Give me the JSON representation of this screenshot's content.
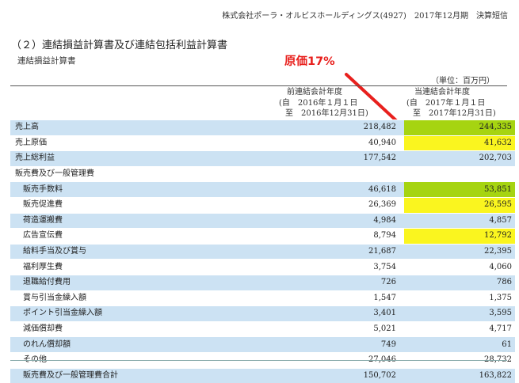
{
  "header": {
    "company_line": "株式会社ポーラ・オルビスホールディングス(4927)　2017年12月期　決算短信"
  },
  "section_title": "（２）連結損益計算書及び連結包括利益計算書",
  "sub_title": "連結損益計算書",
  "annotation": {
    "text": "原価17%",
    "color": "#e8201d"
  },
  "unit": "（単位：百万円）",
  "columns": {
    "prev": {
      "title": "前連結会計年度",
      "from": "(自　2016年１月１日",
      "to": "至　2016年12月31日)"
    },
    "curr": {
      "title": "当連結会計年度",
      "from": "(自　2017年１月１日",
      "to": "至　2017年12月31日)"
    }
  },
  "colors": {
    "row_blue": "#cce2f3",
    "highlight_green": "#a6d411",
    "highlight_yellow": "#faf51f"
  },
  "rows": [
    {
      "label": "売上高",
      "prev": "218,482",
      "curr": "244,335",
      "indent": 0,
      "band": "blue",
      "highlight": "green"
    },
    {
      "label": "売上原価",
      "prev": "40,940",
      "curr": "41,632",
      "indent": 0,
      "band": "white",
      "highlight": "yellow"
    },
    {
      "label": "売上総利益",
      "prev": "177,542",
      "curr": "202,703",
      "indent": 0,
      "band": "blue",
      "highlight": ""
    },
    {
      "label": "販売費及び一般管理費",
      "prev": "",
      "curr": "",
      "indent": 0,
      "band": "white",
      "highlight": ""
    },
    {
      "label": "販売手数料",
      "prev": "46,618",
      "curr": "53,851",
      "indent": 1,
      "band": "blue",
      "highlight": "green"
    },
    {
      "label": "販売促進費",
      "prev": "26,369",
      "curr": "26,595",
      "indent": 1,
      "band": "white",
      "highlight": "yellow"
    },
    {
      "label": "荷造運搬費",
      "prev": "4,984",
      "curr": "4,857",
      "indent": 1,
      "band": "blue",
      "highlight": ""
    },
    {
      "label": "広告宣伝費",
      "prev": "8,794",
      "curr": "12,792",
      "indent": 1,
      "band": "white",
      "highlight": "yellow"
    },
    {
      "label": "給料手当及び賞与",
      "prev": "21,687",
      "curr": "22,395",
      "indent": 1,
      "band": "blue",
      "highlight": ""
    },
    {
      "label": "福利厚生費",
      "prev": "3,754",
      "curr": "4,060",
      "indent": 1,
      "band": "white",
      "highlight": ""
    },
    {
      "label": "退職給付費用",
      "prev": "726",
      "curr": "786",
      "indent": 1,
      "band": "blue",
      "highlight": ""
    },
    {
      "label": "賞与引当金繰入額",
      "prev": "1,547",
      "curr": "1,375",
      "indent": 1,
      "band": "white",
      "highlight": ""
    },
    {
      "label": "ポイント引当金繰入額",
      "prev": "3,401",
      "curr": "3,595",
      "indent": 1,
      "band": "blue",
      "highlight": ""
    },
    {
      "label": "減価償却費",
      "prev": "5,021",
      "curr": "4,717",
      "indent": 1,
      "band": "white",
      "highlight": ""
    },
    {
      "label": "のれん償却額",
      "prev": "749",
      "curr": "61",
      "indent": 1,
      "band": "blue",
      "highlight": ""
    },
    {
      "label": "その他",
      "prev": "27,046",
      "curr": "28,732",
      "indent": 1,
      "band": "white",
      "highlight": ""
    },
    {
      "label": "販売費及び一般管理費合計",
      "prev": "150,702",
      "curr": "163,822",
      "indent": 1,
      "band": "blue",
      "highlight": ""
    }
  ]
}
